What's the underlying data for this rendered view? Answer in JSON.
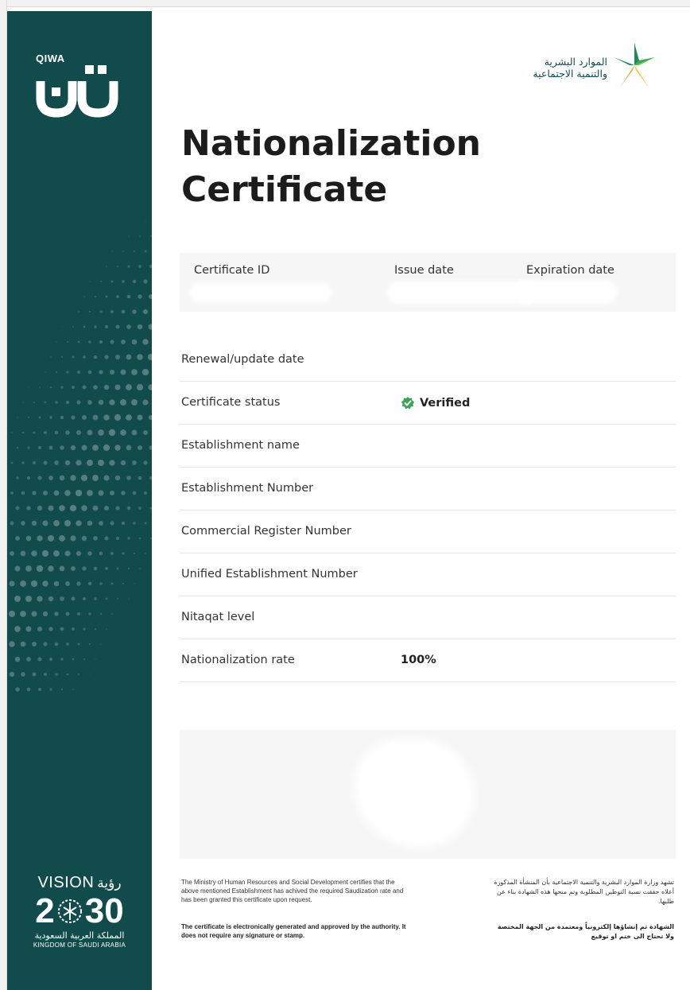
{
  "sidebar": {
    "brand_word": "QIWA",
    "brand_logo_icon": "qiwa-logo-icon",
    "vision_word": "VISION",
    "vision_ar": "رؤية",
    "vision_year_left": "2",
    "vision_year_right": "30",
    "kingdom_ar": "المملكة العربية السعودية",
    "kingdom_en": "KINGDOM OF SAUDI ARABIA",
    "background_color": "#124b4c"
  },
  "ministry_logo": {
    "line1": "الموارد البشرية",
    "line2": "والتنمية الاجتماعية",
    "icon": "ministry-star-icon"
  },
  "title": {
    "line1": "Nationalization",
    "line2": "Certificate"
  },
  "info": {
    "certificate_id_label": "Certificate ID",
    "issue_date_label": "Issue date",
    "expiration_date_label": "Expiration date"
  },
  "rows": [
    {
      "label": "Renewal/update date",
      "value": ""
    },
    {
      "label": "Certificate status",
      "value": "Verified",
      "icon": "verified-check-icon",
      "icon_color": "#3aa35a"
    },
    {
      "label": "Establishment name",
      "value": ""
    },
    {
      "label": "Establishment Number",
      "value": ""
    },
    {
      "label": "Commercial Register Number",
      "value": ""
    },
    {
      "label": "Unified Establishment Number",
      "value": ""
    },
    {
      "label": "Nitaqat level",
      "value": ""
    },
    {
      "label": "Nationalization rate",
      "value": "100%"
    }
  ],
  "footer": {
    "en_statement": "The Ministry of Human Resources and Social Development certifies that the above mentioned Establishment has achived the required Saudization rate and has been granted this certificate upon request.",
    "en_note": "The certificate is electronically generated and approved by the authority. It does not require any signature or stamp.",
    "ar_statement": "تشهد وزارة الموارد البشرية والتنمية الاجتماعية بأن المنشأة المذكورة أعلاه حققت نسبة التوطين المطلوبة وتم منحها هذه الشهادة بناء عن طلبها.",
    "ar_note": "الشهادة تم إنشاؤها إلكترونياً ومعتمدة من الجهة المختصة ولا تحتاج الى ختم او توقيع"
  }
}
